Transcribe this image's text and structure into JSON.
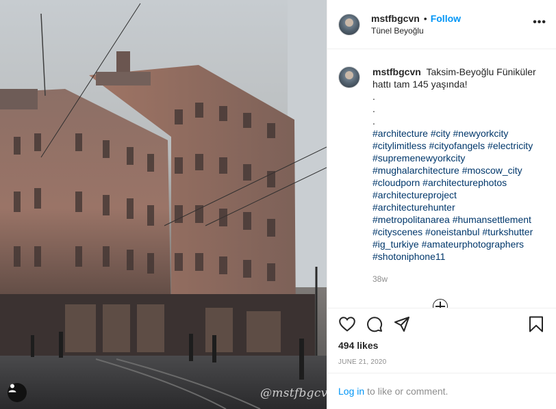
{
  "post": {
    "username": "mstfbgcvn",
    "follow_label": "Follow",
    "dot": "•",
    "location": "Tünel Beyoğlu",
    "more": "•••",
    "caption_lines": [
      "Taksim-Beyoğlu Füniküler",
      "hattı tam 145 yaşında!"
    ],
    "dots": [
      ".",
      ".",
      "."
    ],
    "hashtag_lines": [
      "#architecture #city #newyorkcity",
      "#citylimitless #cityofangels #electricity",
      "#supremenewyorkcity",
      "#mughalarchitecture #moscow_city",
      "#cloudporn #architecturephotos",
      "#architectureproject",
      "#architecturehunter",
      "#metropolitanarea #humansettlement",
      "#cityscenes #oneistanbul #turkshutter",
      "#ig_turkiye #amateurphotographers",
      "#shotoniphone11"
    ],
    "time_ago": "38w",
    "likes": "494 likes",
    "date": "JUNE 21, 2020",
    "login_link": "Log in",
    "login_text": "to like or comment.",
    "watermark": "@mstfbgcvn"
  },
  "icons": [
    "heart-icon",
    "comment-icon",
    "share-icon",
    "bookmark-icon",
    "plus-circle-icon",
    "user-tag-icon"
  ],
  "colors": {
    "accent": "#0095f6",
    "hashtag": "#00376b",
    "muted": "#8e8e8e",
    "text": "#262626"
  }
}
